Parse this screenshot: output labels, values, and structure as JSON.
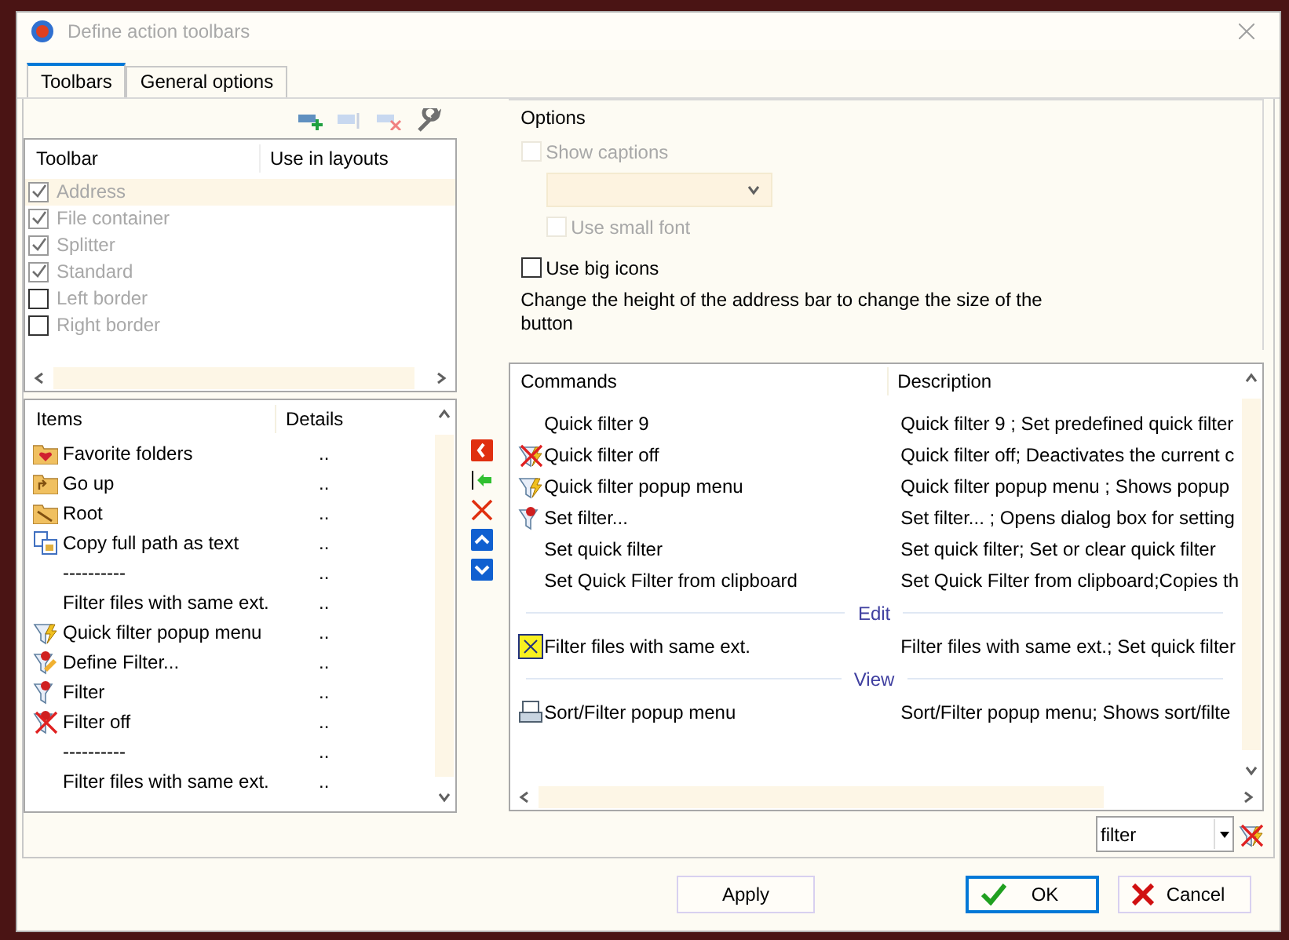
{
  "window": {
    "title": "Define action toolbars"
  },
  "tabs": [
    {
      "label": "Toolbars",
      "selected": true
    },
    {
      "label": "General options",
      "selected": false
    }
  ],
  "toolbar_list": {
    "columns": [
      "Toolbar",
      "Use in layouts"
    ],
    "rows": [
      {
        "label": "Address",
        "checked": true,
        "selected": true
      },
      {
        "label": "File container",
        "checked": true,
        "selected": false
      },
      {
        "label": "Splitter",
        "checked": true,
        "selected": false
      },
      {
        "label": "Standard",
        "checked": true,
        "selected": false
      },
      {
        "label": "Left border",
        "checked": false,
        "selected": false
      },
      {
        "label": "Right border",
        "checked": false,
        "selected": false
      }
    ]
  },
  "items_list": {
    "columns": [
      "Items",
      "Details"
    ],
    "rows": [
      {
        "label": "Favorite folders",
        "details": ".."
      },
      {
        "label": "Go up",
        "details": ".."
      },
      {
        "label": "Root",
        "details": ".."
      },
      {
        "label": "Copy full path as text",
        "details": ".."
      },
      {
        "label": "----------",
        "details": ".."
      },
      {
        "label": "Filter files with same ext.",
        "details": ".."
      },
      {
        "label": "Quick filter popup menu",
        "details": ".."
      },
      {
        "label": "Define Filter...",
        "details": ".."
      },
      {
        "label": "Filter",
        "details": ".."
      },
      {
        "label": "Filter off",
        "details": ".."
      },
      {
        "label": "----------",
        "details": ".."
      },
      {
        "label": "Filter files with same ext.",
        "details": ".."
      }
    ]
  },
  "options": {
    "title": "Options",
    "show_captions": {
      "label": "Show captions",
      "checked": false,
      "disabled": true
    },
    "use_small_font": {
      "label": "Use small font",
      "checked": false,
      "disabled": true
    },
    "use_big_icons": {
      "label": "Use big icons",
      "checked": false,
      "disabled": false
    },
    "note": "Change the height of the address bar to change the size of the button"
  },
  "commands": {
    "columns": [
      "Commands",
      "Description"
    ],
    "rows": [
      {
        "kind": "command",
        "name": "Quick filter 9",
        "description": "Quick filter 9 ; Set predefined quick filter"
      },
      {
        "kind": "command",
        "name": "Quick filter off",
        "description": "Quick filter off; Deactivates the current c"
      },
      {
        "kind": "command",
        "name": "Quick filter popup menu",
        "description": "Quick filter popup menu ; Shows popup"
      },
      {
        "kind": "command",
        "name": "Set filter...",
        "description": "Set filter... ; Opens dialog box for setting"
      },
      {
        "kind": "command",
        "name": "Set quick filter",
        "description": "Set quick filter; Set or clear quick filter"
      },
      {
        "kind": "command",
        "name": "Set Quick Filter from clipboard",
        "description": "Set Quick Filter from clipboard;Copies th"
      },
      {
        "kind": "group",
        "name": "Edit"
      },
      {
        "kind": "command",
        "name": "Filter files with same ext.",
        "description": "Filter files with same ext.; Set quick filter"
      },
      {
        "kind": "group",
        "name": "View"
      },
      {
        "kind": "command",
        "name": "Sort/Filter popup menu",
        "description": "Sort/Filter popup menu; Shows sort/filte"
      }
    ]
  },
  "filter": {
    "value": "filter"
  },
  "buttons": [
    {
      "kind": "apply",
      "label": "Apply"
    },
    {
      "kind": "ok",
      "label": "OK"
    },
    {
      "kind": "cancel",
      "label": "Cancel"
    }
  ]
}
